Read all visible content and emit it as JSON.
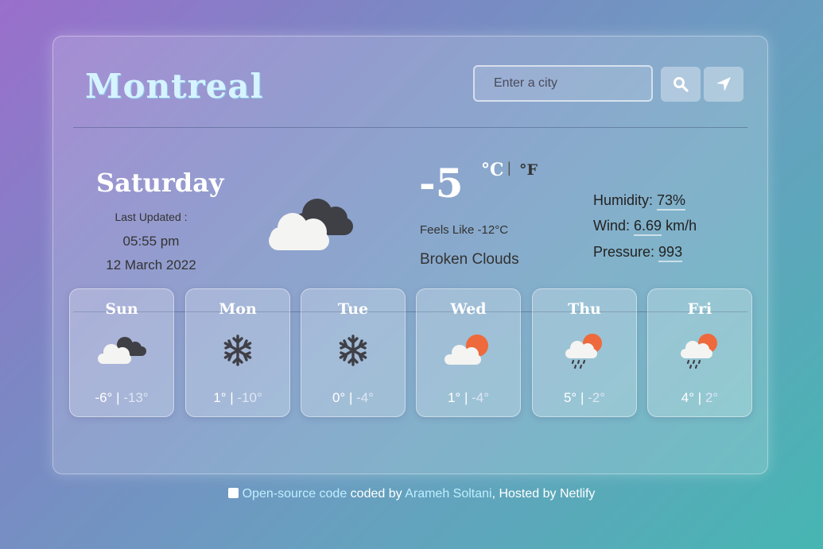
{
  "app": {
    "city": "Montreal",
    "search_placeholder": "Enter a city"
  },
  "icons": {
    "search": "search-icon",
    "location": "location-arrow-icon"
  },
  "current": {
    "day": "Saturday",
    "last_updated_label": "Last Updated :",
    "time": "05:55 pm",
    "date": "12 March 2022",
    "icon": "broken-clouds-icon",
    "temperature": "-5",
    "unit_celsius": "°C",
    "unit_separator": "|",
    "unit_fahrenheit": "°F",
    "feels_like": "Feels Like -12°C",
    "description": "Broken Clouds",
    "humidity_label": "Humidity:",
    "humidity_value": "73%",
    "wind_label": "Wind:",
    "wind_value": "6.69",
    "wind_unit": "km/h",
    "pressure_label": "Pressure:",
    "pressure_value": "993"
  },
  "forecast": [
    {
      "day": "Sun",
      "icon": "broken-clouds-icon",
      "max": "-6°",
      "min": "-13°"
    },
    {
      "day": "Mon",
      "icon": "snowflake-icon",
      "max": "1°",
      "min": "-10°"
    },
    {
      "day": "Tue",
      "icon": "snowflake-icon",
      "max": "0°",
      "min": "-4°"
    },
    {
      "day": "Wed",
      "icon": "partly-cloudy-icon",
      "max": "1°",
      "min": "-4°"
    },
    {
      "day": "Thu",
      "icon": "rain-sun-icon",
      "max": "5°",
      "min": "-2°"
    },
    {
      "day": "Fri",
      "icon": "rain-sun-icon",
      "max": "4°",
      "min": "2°"
    }
  ],
  "footer": {
    "source_link": "Open-source code",
    "coded_by": " coded by ",
    "author_link": "Arameh Soltani",
    "hosted": ", Hosted by Netlify"
  },
  "colors": {
    "card_bg": "rgba(255,255,255,0.18)",
    "accent_link": "#bfeeff",
    "sun": "#ee6a3c",
    "dark_cloud": "#3f3f46",
    "light_cloud": "#f4f4f2"
  },
  "temp_separator": "|"
}
